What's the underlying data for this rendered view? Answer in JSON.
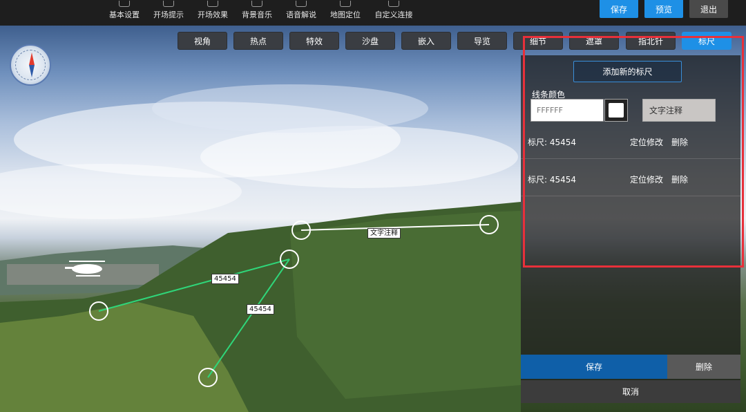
{
  "toolbar": {
    "items": [
      {
        "label": "基本设置",
        "icon": "gear-icon"
      },
      {
        "label": "开场提示",
        "icon": "tip-icon"
      },
      {
        "label": "开场效果",
        "icon": "image-icon"
      },
      {
        "label": "背景音乐",
        "icon": "music-icon"
      },
      {
        "label": "语音解说",
        "icon": "voice-icon"
      },
      {
        "label": "地图定位",
        "icon": "map-icon"
      },
      {
        "label": "自定义连接",
        "icon": "globe-icon"
      }
    ],
    "save": "保存",
    "preview": "预览",
    "exit": "退出"
  },
  "tabs": [
    "视角",
    "热点",
    "特效",
    "沙盘",
    "嵌入",
    "导览",
    "细节",
    "遮罩",
    "指北针",
    "标尺"
  ],
  "active_tab": "标尺",
  "measurements": [
    {
      "label": "45454"
    },
    {
      "label": "45454"
    },
    {
      "label": "文字注释"
    }
  ],
  "panel": {
    "add_ruler": "添加新的标尺",
    "line_color_label": "线条颜色",
    "color_value": "FFFFFF",
    "text_note": "文字注释",
    "rows": [
      {
        "label": "标尺:  45454",
        "locate": "定位修改",
        "delete": "删除"
      },
      {
        "label": "标尺:  45454",
        "locate": "定位修改",
        "delete": "删除"
      }
    ],
    "save": "保存",
    "delete": "删除",
    "cancel": "取消"
  },
  "colors": {
    "accent": "#1e90e6",
    "highlight": "#e8303a",
    "ruler_green": "#2fd67a",
    "ruler_white": "#ffffff"
  }
}
